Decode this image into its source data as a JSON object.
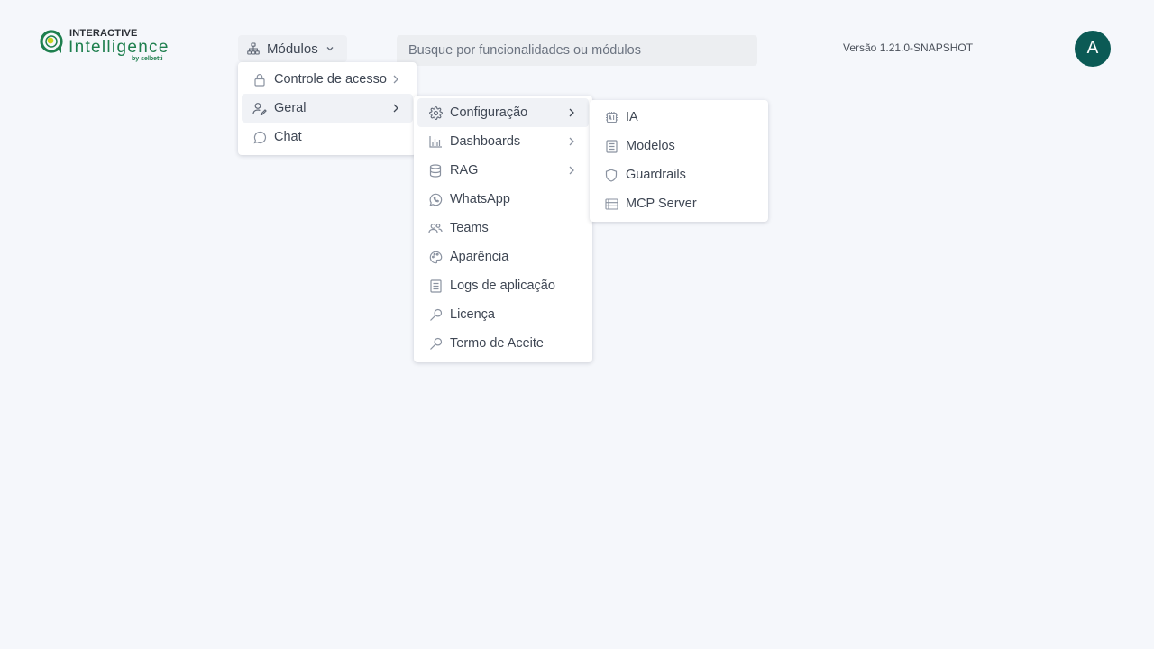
{
  "logo": {
    "top": "INTERACTIVE",
    "main": "Intelligence",
    "sub": "by selbetti"
  },
  "header": {
    "modules_label": "Módulos",
    "search_placeholder": "Busque por funcionalidades ou módulos",
    "version": "Versão 1.21.0-SNAPSHOT",
    "avatar_initial": "A"
  },
  "menu_level1": {
    "items": [
      {
        "label": "Controle de acesso",
        "icon": "lock-icon",
        "has_submenu": true
      },
      {
        "label": "Geral",
        "icon": "user-edit-icon",
        "has_submenu": true,
        "active": true
      },
      {
        "label": "Chat",
        "icon": "chat-bubble-icon",
        "has_submenu": false
      }
    ]
  },
  "menu_level2": {
    "items": [
      {
        "label": "Configuração",
        "icon": "gear-icon",
        "has_submenu": true,
        "active": true
      },
      {
        "label": "Dashboards",
        "icon": "bar-chart-icon",
        "has_submenu": true
      },
      {
        "label": "RAG",
        "icon": "database-icon",
        "has_submenu": true
      },
      {
        "label": "WhatsApp",
        "icon": "whatsapp-icon",
        "has_submenu": false
      },
      {
        "label": "Teams",
        "icon": "users-icon",
        "has_submenu": false
      },
      {
        "label": "Aparência",
        "icon": "palette-icon",
        "has_submenu": false
      },
      {
        "label": "Logs de aplicação",
        "icon": "document-icon",
        "has_submenu": false
      },
      {
        "label": "Licença",
        "icon": "key-icon",
        "has_submenu": false
      },
      {
        "label": "Termo de Aceite",
        "icon": "key-icon",
        "has_submenu": false
      }
    ]
  },
  "menu_level3": {
    "items": [
      {
        "label": "IA",
        "icon": "ai-chip-icon"
      },
      {
        "label": "Modelos",
        "icon": "document-icon"
      },
      {
        "label": "Guardrails",
        "icon": "shield-icon"
      },
      {
        "label": "MCP Server",
        "icon": "server-icon"
      }
    ]
  },
  "colors": {
    "background": "#f5f7fb",
    "brand_green": "#1e7f4e",
    "avatar_bg": "#0b5a55",
    "text": "#3f4754",
    "menu_active": "#f0f2f6"
  }
}
